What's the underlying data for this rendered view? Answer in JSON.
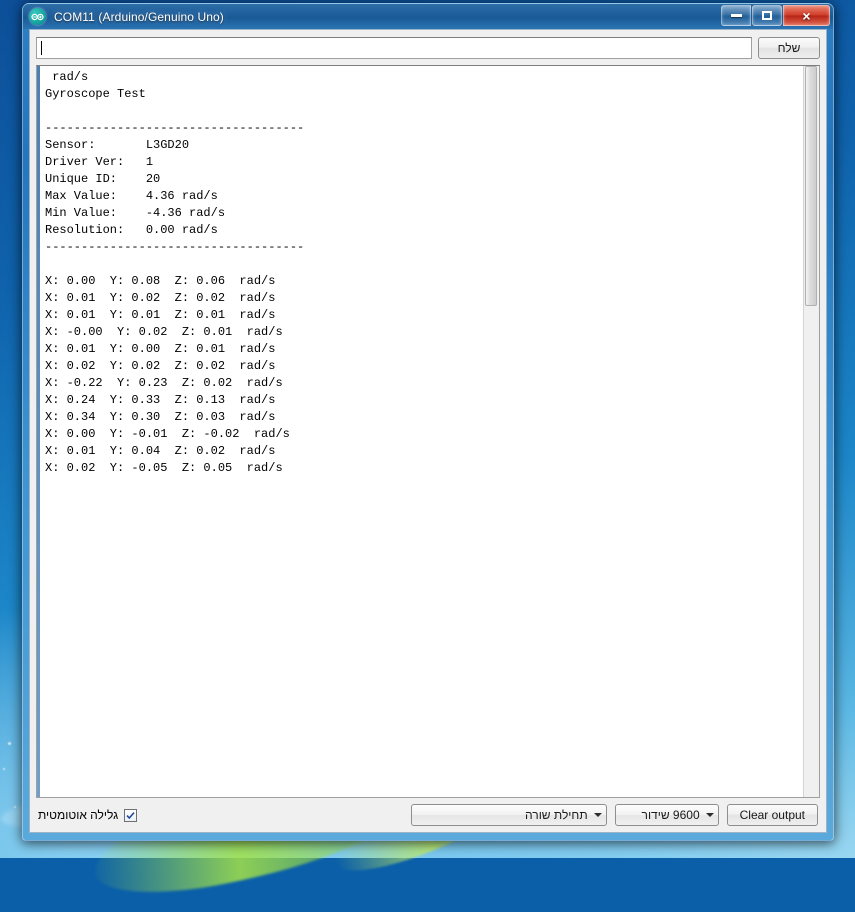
{
  "window": {
    "title": "COM11 (Arduino/Genuino Uno)",
    "app_icon": "arduino-infinity-icon",
    "minimize_glyph": "minimize-icon",
    "maximize_glyph": "maximize-icon",
    "close_glyph": "×"
  },
  "send_row": {
    "input_value": "",
    "input_placeholder": "",
    "send_label": "שלח"
  },
  "console": {
    "lines": [
      " rad/s",
      "Gyroscope Test",
      "",
      "------------------------------------",
      "Sensor:       L3GD20",
      "Driver Ver:   1",
      "Unique ID:    20",
      "Max Value:    4.36 rad/s",
      "Min Value:    -4.36 rad/s",
      "Resolution:   0.00 rad/s",
      "------------------------------------",
      "",
      "X: 0.00  Y: 0.08  Z: 0.06  rad/s",
      "X: 0.01  Y: 0.02  Z: 0.02  rad/s",
      "X: 0.01  Y: 0.01  Z: 0.01  rad/s",
      "X: -0.00  Y: 0.02  Z: 0.01  rad/s",
      "X: 0.01  Y: 0.00  Z: 0.01  rad/s",
      "X: 0.02  Y: 0.02  Z: 0.02  rad/s",
      "X: -0.22  Y: 0.23  Z: 0.02  rad/s",
      "X: 0.24  Y: 0.33  Z: 0.13  rad/s",
      "X: 0.34  Y: 0.30  Z: 0.03  rad/s",
      "X: 0.00  Y: -0.01  Z: -0.02  rad/s",
      "X: 0.01  Y: 0.04  Z: 0.02  rad/s",
      "X: 0.02  Y: -0.05  Z: 0.05  rad/s"
    ],
    "sensor_info": {
      "sensor": "L3GD20",
      "driver_ver": "1",
      "unique_id": "20",
      "max_value": "4.36 rad/s",
      "min_value": "-4.36 rad/s",
      "resolution": "0.00 rad/s"
    },
    "readings": [
      {
        "x": "0.00",
        "y": "0.08",
        "z": "0.06",
        "unit": "rad/s"
      },
      {
        "x": "0.01",
        "y": "0.02",
        "z": "0.02",
        "unit": "rad/s"
      },
      {
        "x": "0.01",
        "y": "0.01",
        "z": "0.01",
        "unit": "rad/s"
      },
      {
        "x": "-0.00",
        "y": "0.02",
        "z": "0.01",
        "unit": "rad/s"
      },
      {
        "x": "0.01",
        "y": "0.00",
        "z": "0.01",
        "unit": "rad/s"
      },
      {
        "x": "0.02",
        "y": "0.02",
        "z": "0.02",
        "unit": "rad/s"
      },
      {
        "x": "-0.22",
        "y": "0.23",
        "z": "0.02",
        "unit": "rad/s"
      },
      {
        "x": "0.24",
        "y": "0.33",
        "z": "0.13",
        "unit": "rad/s"
      },
      {
        "x": "0.34",
        "y": "0.30",
        "z": "0.03",
        "unit": "rad/s"
      },
      {
        "x": "0.00",
        "y": "-0.01",
        "z": "-0.02",
        "unit": "rad/s"
      },
      {
        "x": "0.01",
        "y": "0.04",
        "z": "0.02",
        "unit": "rad/s"
      },
      {
        "x": "0.02",
        "y": "-0.05",
        "z": "0.05",
        "unit": "rad/s"
      }
    ]
  },
  "bottom_bar": {
    "autoscroll_label": "גלילה אוטומטית",
    "autoscroll_checked": true,
    "check_glyph": "check-icon",
    "line_ending_value": "תחילת שורה",
    "baud_value": "9600 שידור",
    "clear_label": "Clear output"
  },
  "colors": {
    "title_bar": "#1d5d99",
    "close_button": "#cf3c28",
    "desktop": "#0f62ab",
    "text": "#000000"
  }
}
